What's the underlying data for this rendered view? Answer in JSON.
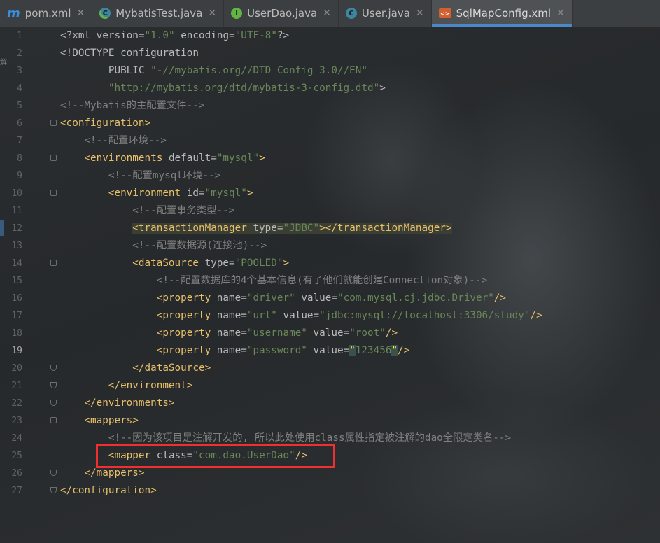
{
  "tabs": [
    {
      "label": "pom.xml",
      "icon": "maven-m-icon",
      "glyph": "m",
      "kind": "m",
      "active": false
    },
    {
      "label": "MybatisTest.java",
      "icon": "java-class-run-icon",
      "glyph": "C",
      "kind": "c-run",
      "active": false
    },
    {
      "label": "UserDao.java",
      "icon": "java-interface-icon",
      "glyph": "I",
      "kind": "i",
      "active": false
    },
    {
      "label": "User.java",
      "icon": "java-class-icon",
      "glyph": "C",
      "kind": "c",
      "active": false
    },
    {
      "label": "SqlMapConfig.xml",
      "icon": "xml-file-icon",
      "glyph": "<>",
      "kind": "xml",
      "active": true
    }
  ],
  "close_glyph": "✕",
  "side_glyph": "解",
  "colors": {
    "accent": "#4a88c7",
    "highlight_box": "#f22f2f",
    "tag": "#e8bf6a",
    "value": "#6a8759",
    "comment": "#808080"
  },
  "editor": {
    "current_line": 19,
    "highlight_box_line": 25,
    "lines": [
      {
        "n": "1",
        "fold": "",
        "tokens": [
          [
            "p",
            "<?xml "
          ],
          [
            "a",
            "version"
          ],
          [
            "p",
            "="
          ],
          [
            "v",
            "\"1.0\""
          ],
          [
            "p",
            " "
          ],
          [
            "a",
            "encoding"
          ],
          [
            "p",
            "="
          ],
          [
            "v",
            "\"UTF-8\""
          ],
          [
            "p",
            "?>"
          ]
        ],
        "indent": 0
      },
      {
        "n": "2",
        "fold": "",
        "tokens": [
          [
            "p",
            "<!DOCTYPE configuration"
          ]
        ],
        "indent": 0
      },
      {
        "n": "3",
        "fold": "",
        "tokens": [
          [
            "p",
            "        PUBLIC "
          ],
          [
            "v",
            "\"-//mybatis.org//DTD Config 3.0//EN\""
          ]
        ],
        "indent": 0
      },
      {
        "n": "4",
        "fold": "",
        "tokens": [
          [
            "v",
            "        \"http://mybatis.org/dtd/mybatis-3-config.dtd\""
          ],
          [
            "p",
            ">"
          ]
        ],
        "indent": 0
      },
      {
        "n": "5",
        "fold": "",
        "tokens": [
          [
            "c",
            "<!--Mybatis的主配置文件-->"
          ]
        ],
        "indent": 0
      },
      {
        "n": "6",
        "fold": "start",
        "tokens": [
          [
            "t",
            "<configuration>"
          ]
        ],
        "indent": 0
      },
      {
        "n": "7",
        "fold": "",
        "tokens": [
          [
            "c",
            "    <!--配置环境-->"
          ]
        ],
        "indent": 0
      },
      {
        "n": "8",
        "fold": "start",
        "tokens": [
          [
            "t",
            "    <environments "
          ],
          [
            "a",
            "default"
          ],
          [
            "p",
            "="
          ],
          [
            "v",
            "\"mysql\""
          ],
          [
            "t",
            ">"
          ]
        ],
        "indent": 0
      },
      {
        "n": "9",
        "fold": "",
        "tokens": [
          [
            "c",
            "        <!--配置mysql环境-->"
          ]
        ],
        "indent": 0
      },
      {
        "n": "10",
        "fold": "start",
        "tokens": [
          [
            "t",
            "        <environment "
          ],
          [
            "a",
            "id"
          ],
          [
            "p",
            "="
          ],
          [
            "v",
            "\"mysql\""
          ],
          [
            "t",
            ">"
          ]
        ],
        "indent": 0
      },
      {
        "n": "11",
        "fold": "",
        "tokens": [
          [
            "c",
            "            <!--配置事务类型-->"
          ]
        ],
        "indent": 0
      },
      {
        "n": "12",
        "fold": "",
        "tokens": [
          [
            "p",
            "            "
          ],
          [
            "hlt",
            "<transactionManager "
          ],
          [
            "hla",
            "type"
          ],
          [
            "hlp",
            "="
          ],
          [
            "hlv",
            "\"JDBC\""
          ],
          [
            "hlt",
            "></transactionManager>"
          ]
        ],
        "indent": 0
      },
      {
        "n": "13",
        "fold": "",
        "tokens": [
          [
            "c",
            "            <!--配置数据源(连接池)-->"
          ]
        ],
        "indent": 0
      },
      {
        "n": "14",
        "fold": "start",
        "tokens": [
          [
            "t",
            "            <dataSource "
          ],
          [
            "a",
            "type"
          ],
          [
            "p",
            "="
          ],
          [
            "v",
            "\"POOLED\""
          ],
          [
            "t",
            ">"
          ]
        ],
        "indent": 0
      },
      {
        "n": "15",
        "fold": "",
        "tokens": [
          [
            "c",
            "                <!--配置数据库的4个基本信息(有了他们就能创建Connection对象)-->"
          ]
        ],
        "indent": 0
      },
      {
        "n": "16",
        "fold": "",
        "tokens": [
          [
            "t",
            "                <property "
          ],
          [
            "a",
            "name"
          ],
          [
            "p",
            "="
          ],
          [
            "v",
            "\"driver\""
          ],
          [
            "p",
            " "
          ],
          [
            "a",
            "value"
          ],
          [
            "p",
            "="
          ],
          [
            "v",
            "\"com.mysql.cj.jdbc.Driver\""
          ],
          [
            "t",
            "/>"
          ]
        ],
        "indent": 0
      },
      {
        "n": "17",
        "fold": "",
        "tokens": [
          [
            "t",
            "                <property "
          ],
          [
            "a",
            "name"
          ],
          [
            "p",
            "="
          ],
          [
            "v",
            "\"url\""
          ],
          [
            "p",
            " "
          ],
          [
            "a",
            "value"
          ],
          [
            "p",
            "="
          ],
          [
            "v",
            "\"jdbc:mysql://localhost:3306/study\""
          ],
          [
            "t",
            "/>"
          ]
        ],
        "indent": 0
      },
      {
        "n": "18",
        "fold": "",
        "tokens": [
          [
            "t",
            "                <property "
          ],
          [
            "a",
            "name"
          ],
          [
            "p",
            "="
          ],
          [
            "v",
            "\"username\""
          ],
          [
            "p",
            " "
          ],
          [
            "a",
            "value"
          ],
          [
            "p",
            "="
          ],
          [
            "v",
            "\"root\""
          ],
          [
            "t",
            "/>"
          ]
        ],
        "indent": 0
      },
      {
        "n": "19",
        "fold": "",
        "tokens": [
          [
            "t",
            "                <property "
          ],
          [
            "a",
            "name"
          ],
          [
            "p",
            "="
          ],
          [
            "v",
            "\"password\""
          ],
          [
            "p",
            " "
          ],
          [
            "a",
            "value"
          ],
          [
            "p",
            "="
          ],
          [
            "bq",
            "\""
          ],
          [
            "v",
            "123456"
          ],
          [
            "bq",
            "\""
          ],
          [
            "t",
            "/>"
          ]
        ],
        "indent": 0
      },
      {
        "n": "20",
        "fold": "end",
        "tokens": [
          [
            "t",
            "            </dataSource>"
          ]
        ],
        "indent": 0
      },
      {
        "n": "21",
        "fold": "end",
        "tokens": [
          [
            "t",
            "        </environment>"
          ]
        ],
        "indent": 0
      },
      {
        "n": "22",
        "fold": "end",
        "tokens": [
          [
            "t",
            "    </environments>"
          ]
        ],
        "indent": 0
      },
      {
        "n": "23",
        "fold": "start",
        "tokens": [
          [
            "t",
            "    <mappers>"
          ]
        ],
        "indent": 0
      },
      {
        "n": "24",
        "fold": "",
        "tokens": [
          [
            "c",
            "        <!--因为该项目是注解开发的, 所以此处使用class属性指定被注解的dao全限定类名-->"
          ]
        ],
        "indent": 0
      },
      {
        "n": "25",
        "fold": "",
        "tokens": [
          [
            "t",
            "        <mapper "
          ],
          [
            "a",
            "class"
          ],
          [
            "p",
            "="
          ],
          [
            "v",
            "\"com.dao.UserDao\""
          ],
          [
            "t",
            "/>"
          ]
        ],
        "indent": 0
      },
      {
        "n": "26",
        "fold": "end",
        "tokens": [
          [
            "t",
            "    </mappers>"
          ]
        ],
        "indent": 0
      },
      {
        "n": "27",
        "fold": "end",
        "tokens": [
          [
            "t",
            "</configuration>"
          ]
        ],
        "indent": 0
      }
    ]
  }
}
